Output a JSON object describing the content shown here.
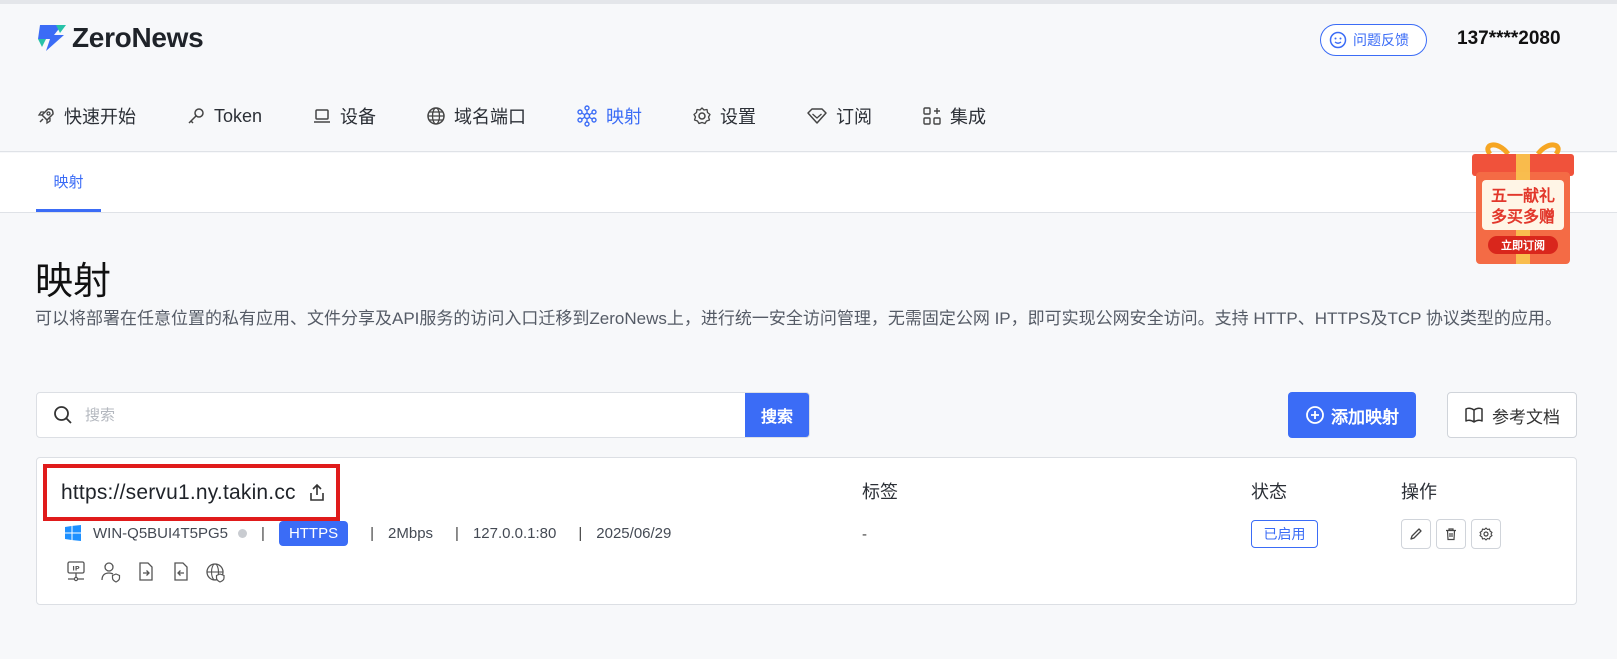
{
  "app": {
    "name": "ZeroNews"
  },
  "header": {
    "feedback_label": "问题反馈",
    "user_phone": "137****2080"
  },
  "nav": [
    {
      "label": "快速开始",
      "icon": "rocket-icon",
      "active": false
    },
    {
      "label": "Token",
      "icon": "key-icon",
      "active": false
    },
    {
      "label": "设备",
      "icon": "laptop-icon",
      "active": false
    },
    {
      "label": "域名端口",
      "icon": "globe-icon",
      "active": false
    },
    {
      "label": "映射",
      "icon": "network-icon",
      "active": true
    },
    {
      "label": "设置",
      "icon": "gear-icon",
      "active": false
    },
    {
      "label": "订阅",
      "icon": "diamond-icon",
      "active": false
    },
    {
      "label": "集成",
      "icon": "grid-plus-icon",
      "active": false
    }
  ],
  "subtab": {
    "label": "映射"
  },
  "promo": {
    "line1": "五一献礼",
    "line2": "多买多赠",
    "button": "立即订阅"
  },
  "page": {
    "title": "映射",
    "description": "可以将部署在任意位置的私有应用、文件分享及API服务的访问入口迁移到ZeroNews上，进行统一安全访问管理，无需固定公网 IP，即可实现公网安全访问。支持 HTTP、HTTPS及TCP 协议类型的应用。"
  },
  "search": {
    "placeholder": "搜索",
    "button_label": "搜索"
  },
  "actions": {
    "add_label": "添加映射",
    "docs_label": "参考文档"
  },
  "mapping": {
    "url": "https://servu1.ny.takin.cc",
    "columns": {
      "tags": "标签",
      "status": "状态",
      "ops": "操作"
    },
    "device": "WIN-Q5BUI4T5PG5",
    "protocol": "HTTPS",
    "bandwidth": "2Mbps",
    "target": "127.0.0.1:80",
    "date": "2025/06/29",
    "tags_value": "-",
    "status": "已启用"
  },
  "colors": {
    "accent": "#3b6cf6",
    "highlight_border": "#e01b1b"
  }
}
